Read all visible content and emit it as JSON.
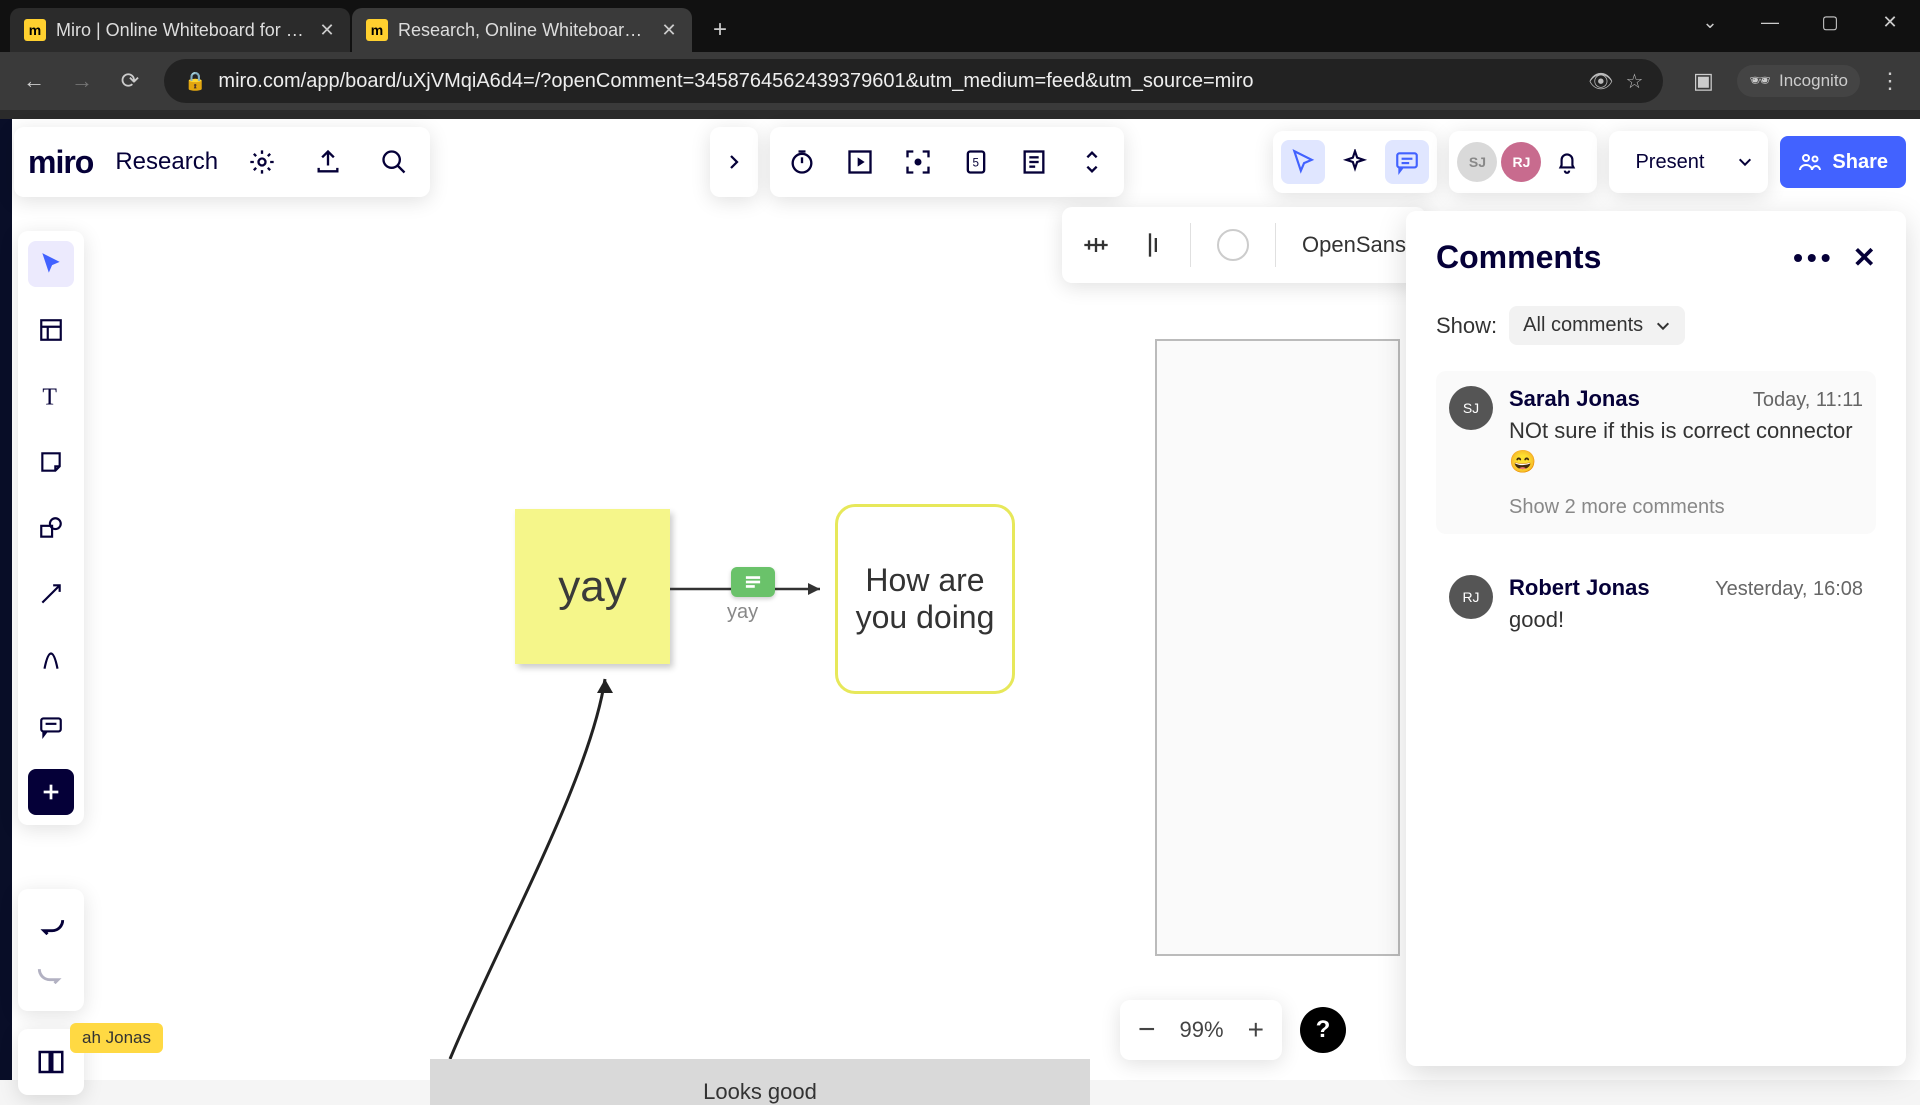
{
  "browser": {
    "tabs": [
      {
        "title": "Miro | Online Whiteboard for Vis",
        "active": false
      },
      {
        "title": "Research, Online Whiteboard for",
        "active": true
      }
    ],
    "url": "miro.com/app/board/uXjVMqiA6d4=/?openComment=3458764562439379601&utm_medium=feed&utm_source=miro",
    "incognito_label": "Incognito"
  },
  "header": {
    "logo": "miro",
    "board_name": "Research",
    "present_label": "Present",
    "share_label": "Share",
    "avatars": [
      {
        "initials": "SJ",
        "bg": "#cfcfcf",
        "fg": "#777"
      },
      {
        "initials": "RJ",
        "bg": "#c86b8e",
        "fg": "#fff"
      }
    ]
  },
  "context_bar": {
    "font": "OpenSans"
  },
  "canvas": {
    "sticky_text": "yay",
    "shape_text": "How are you doing",
    "connector_label": "yay",
    "bottom_shape_text": "Looks good",
    "cursor_tag": "ah Jonas"
  },
  "zoom": {
    "value": "99%"
  },
  "comments_panel": {
    "title": "Comments",
    "filter_label": "Show:",
    "filter_value": "All comments",
    "items": [
      {
        "avatar": "SJ",
        "name": "Sarah Jonas",
        "time": "Today, 11:11",
        "text": "NOt sure if this is correct connector 😄",
        "more": "Show 2 more comments"
      },
      {
        "avatar": "RJ",
        "name": "Robert Jonas",
        "time": "Yesterday, 16:08",
        "text": "good!"
      }
    ]
  }
}
